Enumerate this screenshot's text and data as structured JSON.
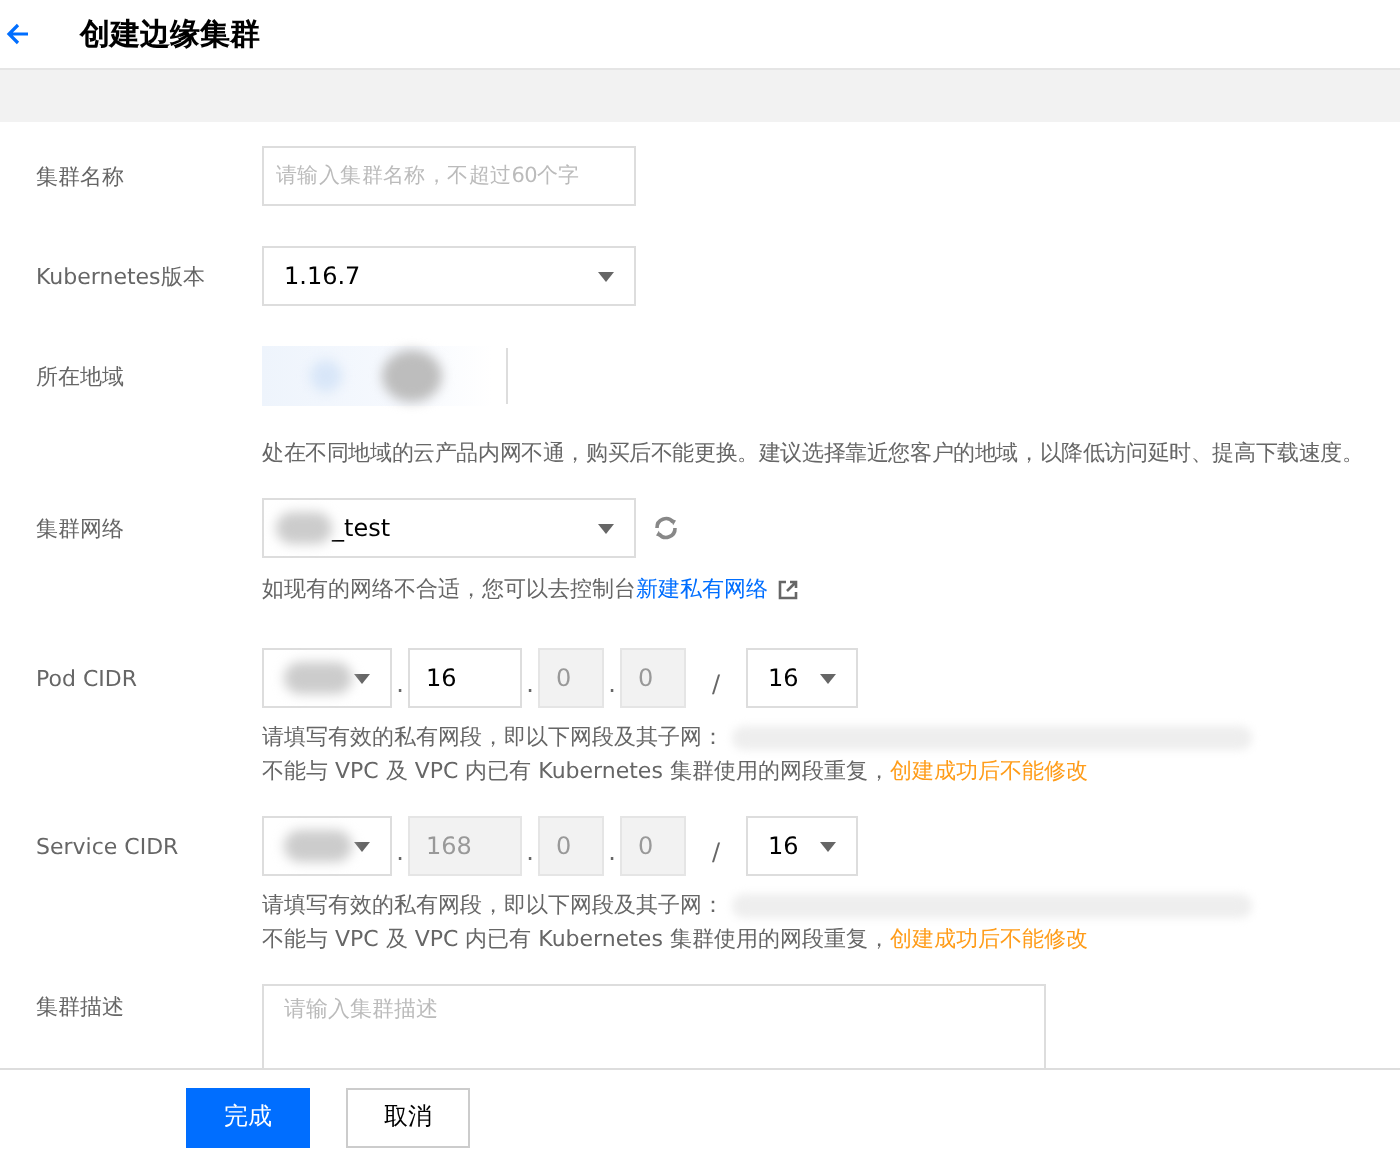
{
  "page": {
    "title": "创建边缘集群"
  },
  "fields": [
    {
      "kind": "text",
      "label": "集群名称",
      "placeholder": "请输入集群名称，不超过60个字"
    },
    {
      "kind": "select",
      "label": "Kubernetes版本",
      "value": "1.16.7"
    },
    {
      "kind": "region",
      "label": "所在地域",
      "hint": "处在不同地域的云产品内网不通，购买后不能更换。建议选择靠近您客户的地域，以降低访问延时、提高下载速度。"
    },
    {
      "kind": "network",
      "label": "集群网络",
      "value": "_test",
      "hint": "如现有的网络不合适，您可以去控制台",
      "link": "新建私有网络"
    },
    {
      "kind": "cidr",
      "label": "Pod CIDR",
      "octets": [
        {
          "value": "16",
          "disabled": false
        },
        {
          "value": "0",
          "disabled": true
        },
        {
          "value": "0",
          "disabled": true
        }
      ],
      "separators": [
        ".",
        ".",
        ".",
        "/"
      ],
      "mask": "16",
      "hint": "请填写有效的私有网段，即以下网段及其子网：",
      "warning": "不能与 VPC 及 VPC 内已有 Kubernetes 集群使用的网段重复，",
      "warning_emphasis": "创建成功后不能修改"
    },
    {
      "kind": "cidr",
      "label": "Service CIDR",
      "octets": [
        {
          "value": "168",
          "disabled": true
        },
        {
          "value": "0",
          "disabled": true
        },
        {
          "value": "0",
          "disabled": true
        }
      ],
      "separators": [
        ".",
        ".",
        ".",
        "/"
      ],
      "mask": "16",
      "hint": "请填写有效的私有网段，即以下网段及其子网：",
      "warning": "不能与 VPC 及 VPC 内已有 Kubernetes 集群使用的网段重复，",
      "warning_emphasis": "创建成功后不能修改"
    },
    {
      "kind": "textarea",
      "label": "集群描述",
      "placeholder": "请输入集群描述"
    }
  ],
  "footer": {
    "buttons": [
      {
        "label": "完成",
        "kind": "primary"
      },
      {
        "label": "取消",
        "kind": "default"
      }
    ]
  }
}
